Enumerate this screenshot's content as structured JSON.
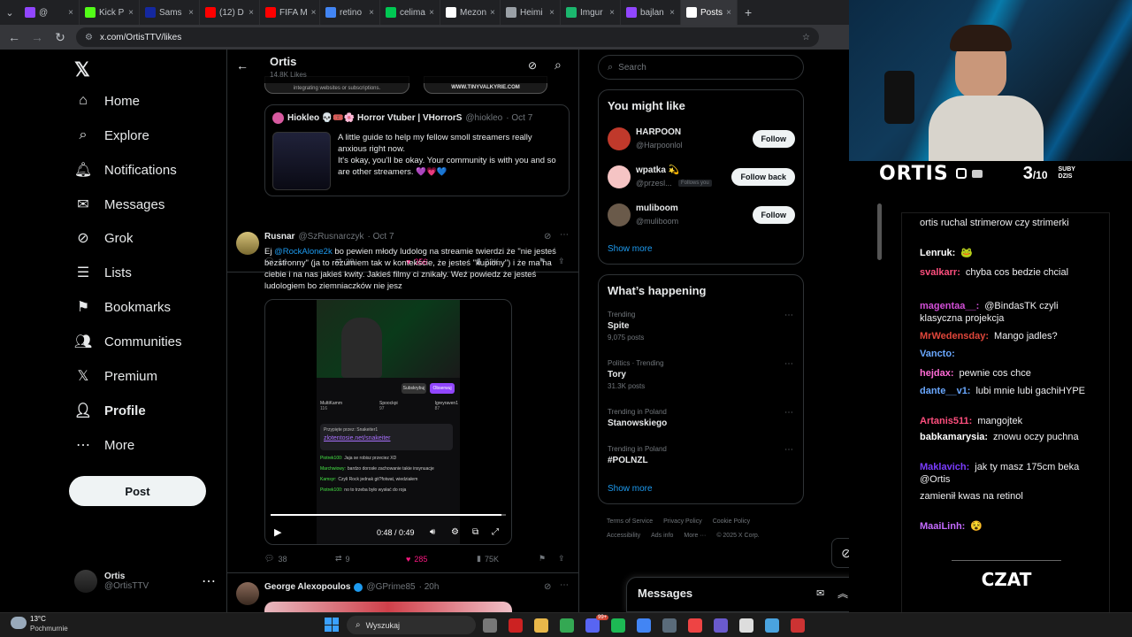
{
  "browser": {
    "tabs": [
      {
        "label": "@",
        "color": "#9146ff"
      },
      {
        "label": "Kick P",
        "color": "#53fc18"
      },
      {
        "label": "Sams",
        "color": "#1428a0"
      },
      {
        "label": "(12) D",
        "color": "#ff0000"
      },
      {
        "label": "FIFA M",
        "color": "#ff0000"
      },
      {
        "label": "retino",
        "color": "#4285f4"
      },
      {
        "label": "celima",
        "color": "#00c853"
      },
      {
        "label": "Mezon",
        "color": "#ffffff"
      },
      {
        "label": "Heimi",
        "color": "#9aa0a6"
      },
      {
        "label": "Imgur",
        "color": "#1bb76e"
      },
      {
        "label": "bajlan",
        "color": "#9146ff"
      },
      {
        "label": "Posts",
        "color": "#ffffff"
      }
    ],
    "url": "x.com/OrtisTTV/likes"
  },
  "nav": {
    "items": [
      {
        "label": "Home",
        "icon": "home-icon",
        "glyph": "⌂"
      },
      {
        "label": "Explore",
        "icon": "search-icon",
        "glyph": "⌕"
      },
      {
        "label": "Notifications",
        "icon": "bell-icon",
        "glyph": "🔔︎"
      },
      {
        "label": "Messages",
        "icon": "mail-icon",
        "glyph": "✉"
      },
      {
        "label": "Grok",
        "icon": "grok-icon",
        "glyph": "⊘"
      },
      {
        "label": "Lists",
        "icon": "list-icon",
        "glyph": "☰"
      },
      {
        "label": "Bookmarks",
        "icon": "bookmark-icon",
        "glyph": "⚑"
      },
      {
        "label": "Communities",
        "icon": "communities-icon",
        "glyph": "👥︎"
      },
      {
        "label": "Premium",
        "icon": "x-logo-icon",
        "glyph": "𝕏"
      },
      {
        "label": "Profile",
        "icon": "person-icon",
        "glyph": "👤︎"
      },
      {
        "label": "More",
        "icon": "more-circle-icon",
        "glyph": "⋯"
      }
    ],
    "post_label": "Post",
    "account": {
      "name": "Ortis",
      "handle": "@OrtisTTV"
    }
  },
  "feed": {
    "title": "Ortis",
    "subtitle": "14.8K Likes",
    "top_media_left": "integrating websites or subscriptions.",
    "top_media_right": "WWW.TINYVALKYRIE.COM",
    "quoted": {
      "name": "Hiokleo 💀🎟️🌸 Horror Vtuber | VHorrorS",
      "handle": "@hiokleo",
      "date": "· Oct 7",
      "text": "A little guide to help my fellow smoll streamers really anxious right now.\nIt's okay, you'll be okay. Your community is with you and so are other streamers. 💜💗💙"
    },
    "tweet1_actions": {
      "replies": "14",
      "retweets": "38",
      "likes": "356",
      "views": "23K"
    },
    "tweet2": {
      "name": "Rusnar",
      "handle": "@SzRusnarczyk",
      "date": "· Oct 7",
      "text_pre": "Ej ",
      "mention": "@RockAlone2k",
      "text_post": " bo pewien młody ludolog na streamie twierdzi że \"nie jesteś bezstronny\" (ja to rozumiem tak w kontekście, że jesteś \"kupiony\") i że ma na ciebie i na nas jakieś kwity. Jakieś filmy ci znikały. Weź powiedz że jesteś ludologiem bo ziemniaczków nie jesz",
      "video": {
        "time": "0:48 / 0:49",
        "progress": 0.98,
        "pinned_label": "Przypięte przez: Snakeiter1",
        "pinned_link": "zlotentosie.net/snakeiter",
        "subscribe": "Subskrybuj",
        "observe": "Obserwuj",
        "stats": [
          {
            "name": "MultiKamm",
            "val": "116"
          },
          {
            "name": "Spoockpi",
            "val": "97"
          },
          {
            "name": "Igreyraven1",
            "val": "87"
          }
        ],
        "chat": [
          {
            "user": "Piotrek100:",
            "msg": "Jaja se robisz przeciez XD"
          },
          {
            "user": "Marchwiowy:",
            "msg": "bardzo dorosłe zachowanie takie insynuacje"
          },
          {
            "user": "Kamsyr:",
            "msg": "Czyli Rock jednak git?fotwat, wiedziałem"
          },
          {
            "user": "Piotrek100:",
            "msg": "no to trzeba było wysłać do roja"
          }
        ]
      },
      "actions": {
        "replies": "38",
        "retweets": "9",
        "likes": "285",
        "views": "75K"
      }
    },
    "tweet3": {
      "name": "George Alexopoulos",
      "handle": "@GPrime85",
      "date": "· 20h"
    }
  },
  "sidebar": {
    "search_placeholder": "Search",
    "you_might_like": "You might like",
    "suggestions": [
      {
        "name": "HARPOON",
        "handle": "@Harpoonlol",
        "button": "Follow",
        "badge": ""
      },
      {
        "name": "wpatka 💫",
        "handle": "@przesl...",
        "button": "Follow back",
        "badge": "Follows you"
      },
      {
        "name": "muliboom",
        "handle": "@muliboom",
        "button": "Follow",
        "badge": ""
      }
    ],
    "show_more": "Show more",
    "whats_happening": "What’s happening",
    "trends": [
      {
        "category": "Trending",
        "name": "Spite",
        "count": "9,075 posts"
      },
      {
        "category": "Politics · Trending",
        "name": "Tory",
        "count": "31.3K posts"
      },
      {
        "category": "Trending in Poland",
        "name": "Stanowskiego",
        "count": ""
      },
      {
        "category": "Trending in Poland",
        "name": "#POLNZL",
        "count": ""
      }
    ],
    "footer_line1": [
      "Terms of Service",
      "Privacy Policy",
      "Cookie Policy"
    ],
    "footer_line2": [
      "Accessibility",
      "Ads info",
      "More ···",
      "© 2025 X Corp."
    ],
    "messages": "Messages"
  },
  "stream": {
    "channel": "ORTIS",
    "sub_count": "3",
    "sub_goal": "/10",
    "sub_caption_1": "SUBY",
    "sub_caption_2": "DZIS",
    "chat_title": "CZAT",
    "chat": [
      {
        "user": "",
        "msg": "ortis ruchal strimerow czy strimerki",
        "color": "#efeff1"
      },
      {
        "user": "Lenruk:",
        "msg": "🐸",
        "color": "#ffffff"
      },
      {
        "user": "svalkarr:",
        "msg": "chyba cos bedzie chcial",
        "color": "#ff4f7e"
      },
      {
        "user": "magentaa__:",
        "msg": "@BindasTK czyli klasyczna projekcja",
        "color": "#d34fd8"
      },
      {
        "user": "MrWedensday:",
        "msg": "Mango jadles?",
        "color": "#e0463a"
      },
      {
        "user": "Vancto:",
        "msg": "",
        "color": "#6aa8ff"
      },
      {
        "user": "hejdax:",
        "msg": "pewnie cos chce",
        "color": "#ff6bd5"
      },
      {
        "user": "dante__v1:",
        "msg": "lubi mnie lubi gachiHYPE",
        "color": "#6aa8ff"
      },
      {
        "user": "Artanis511:",
        "msg": "mangojtek",
        "color": "#ff4f7e"
      },
      {
        "user": "babkamarysia:",
        "msg": "znowu oczy puchna",
        "color": "#ffffff"
      },
      {
        "user": "Maklavich:",
        "msg": "jak ty masz 175cm beka @Ortis",
        "color": "#7a3cff"
      },
      {
        "user": "",
        "msg": "zamienił kwas na retinol",
        "color": "#efeff1"
      },
      {
        "user": "MaaiLinh:",
        "msg": "😵",
        "color": "#c46bff"
      }
    ]
  },
  "taskbar": {
    "temp": "13°C",
    "weather": "Pochmurnie",
    "search_placeholder": "Wyszukaj",
    "badge": "99+"
  }
}
